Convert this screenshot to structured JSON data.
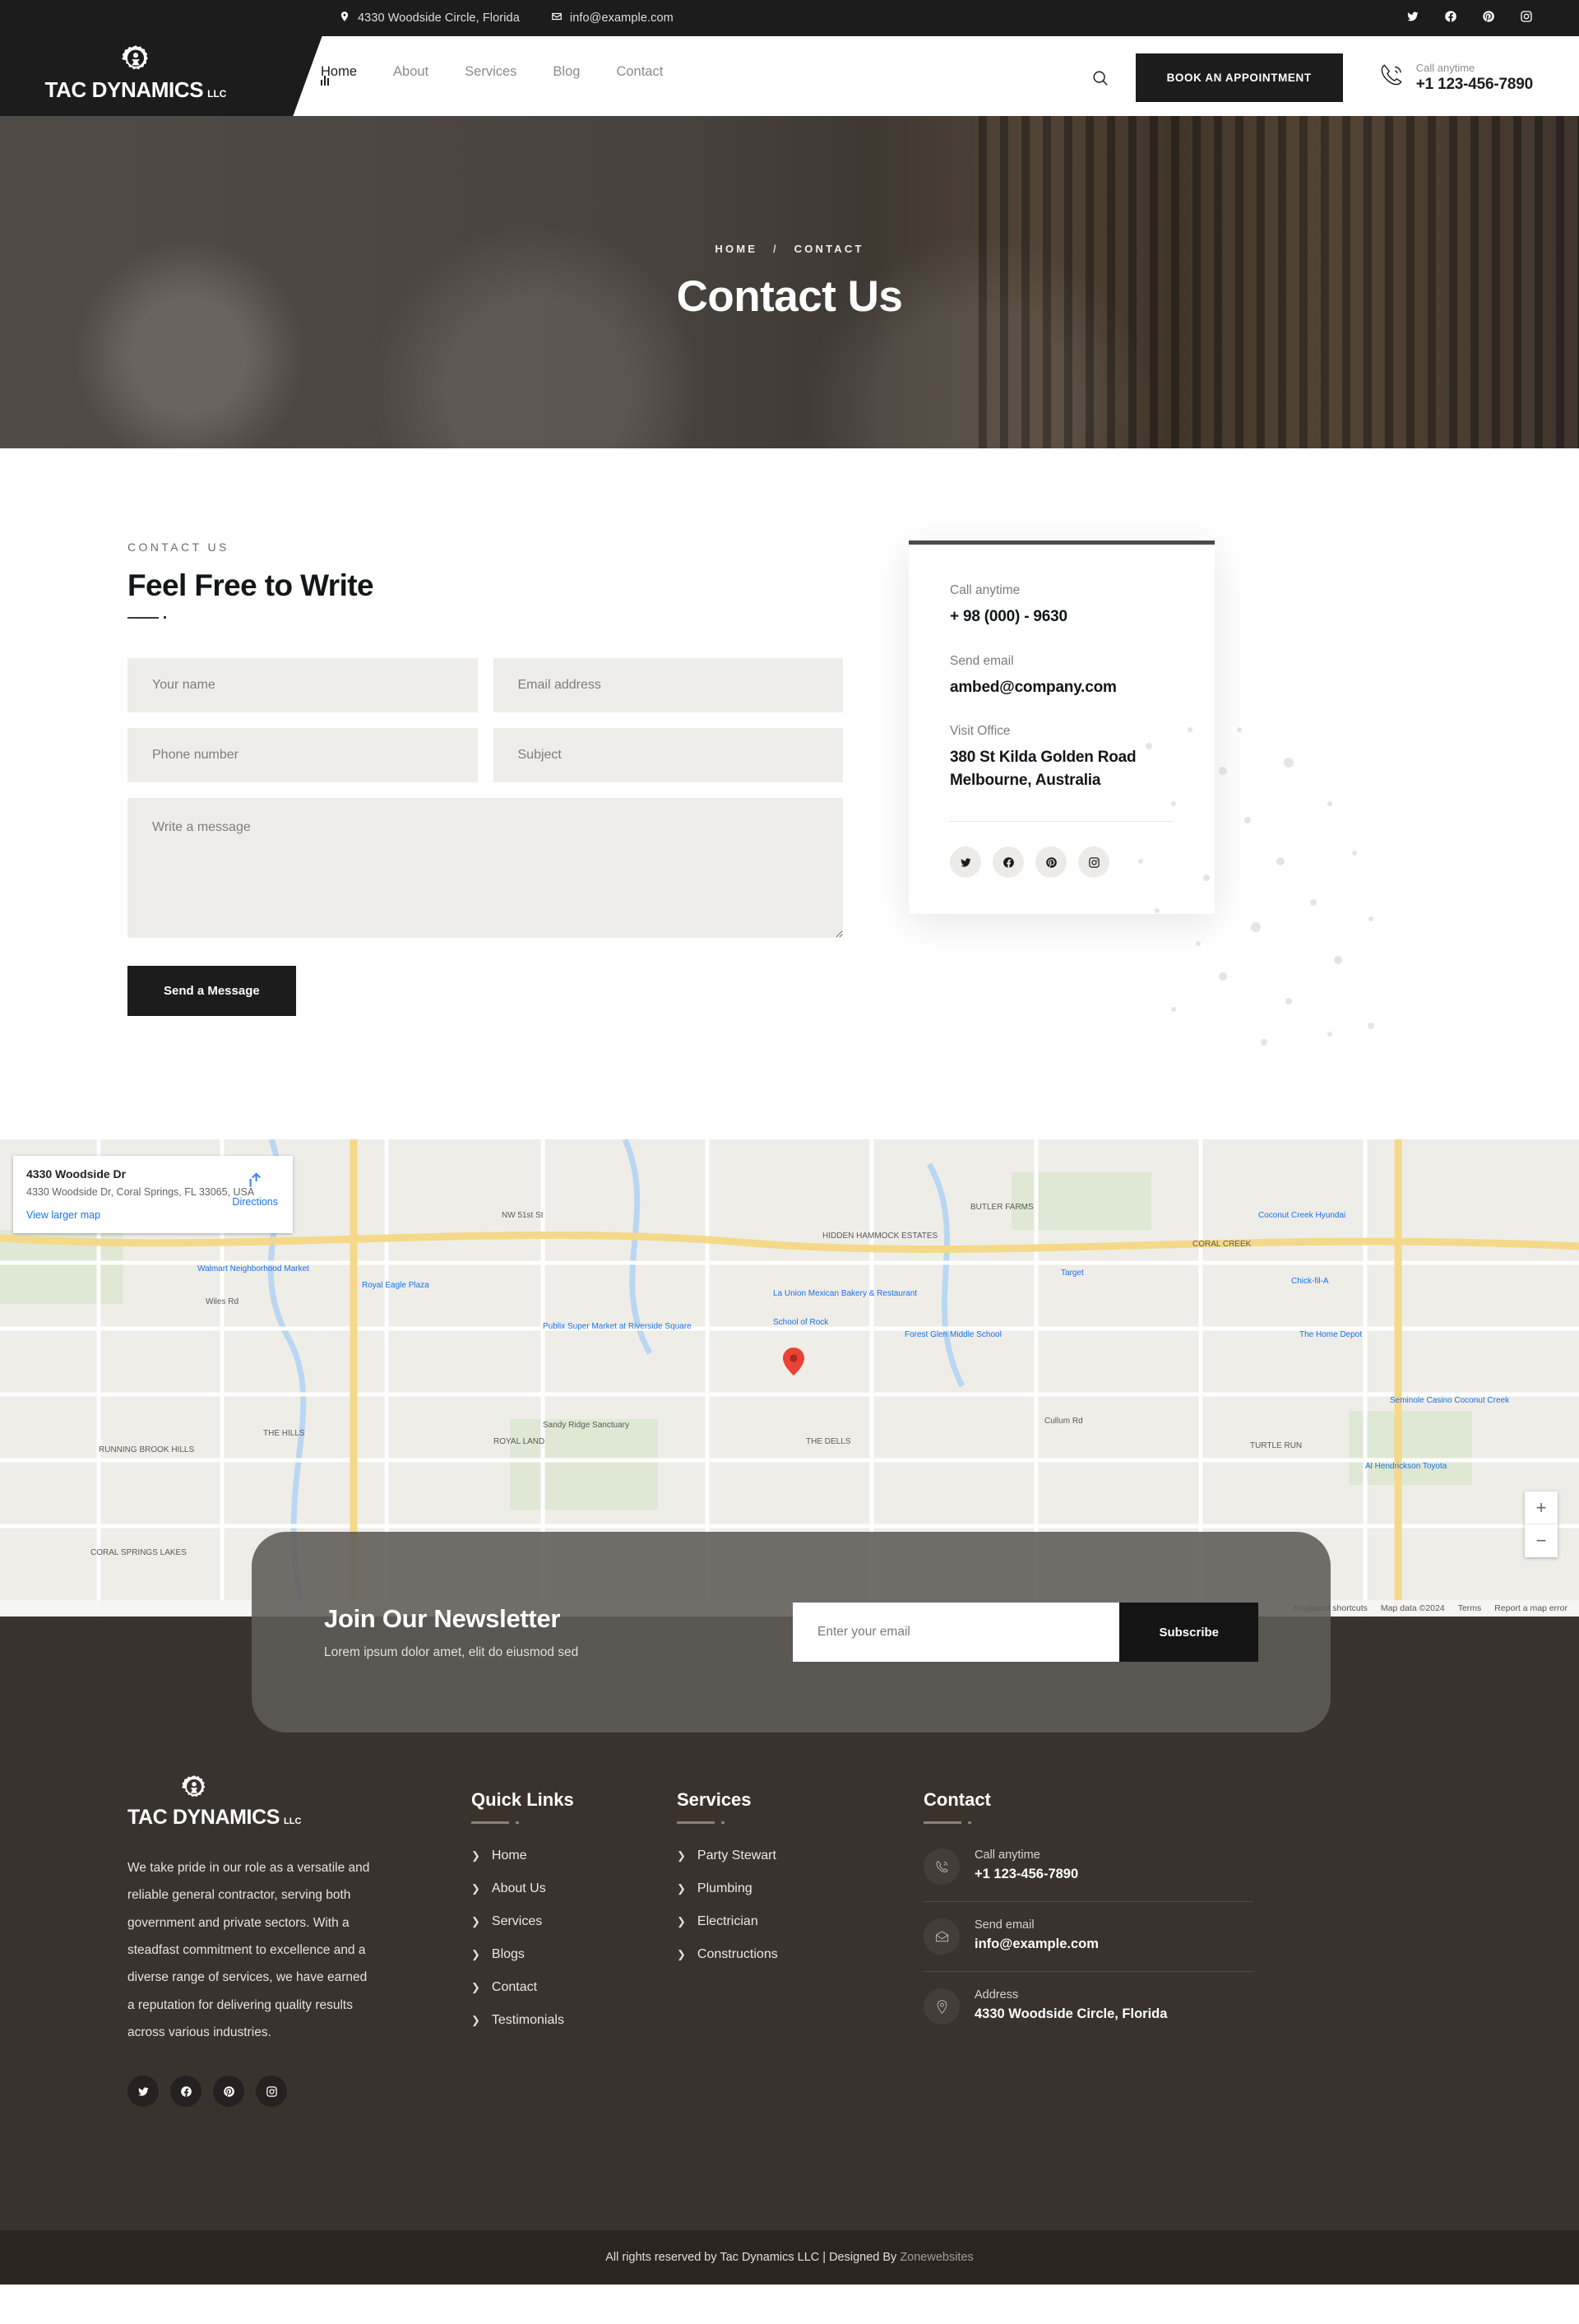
{
  "topbar": {
    "address": "4330 Woodside Circle, Florida",
    "email": "info@example.com",
    "socials": [
      "twitter-icon",
      "facebook-icon",
      "pinterest-icon",
      "instagram-icon"
    ]
  },
  "brand": {
    "name": "TAC DYNAMICS",
    "suffix": "LLC"
  },
  "nav": {
    "items": [
      {
        "label": "Home",
        "active": true
      },
      {
        "label": "About",
        "active": false
      },
      {
        "label": "Services",
        "active": false
      },
      {
        "label": "Blog",
        "active": false
      },
      {
        "label": "Contact",
        "active": false
      }
    ],
    "search_icon": "search-icon",
    "appointment_button": "BOOK AN APPOINTMENT",
    "phone_label": "Call anytime",
    "phone_number": "+1 123-456-7890"
  },
  "hero": {
    "crumb_home": "HOME",
    "crumb_sep": "/",
    "crumb_current": "CONTACT",
    "title": "Contact Us"
  },
  "contact": {
    "eyebrow": "CONTACT US",
    "title": "Feel Free to Write",
    "fields": {
      "name_placeholder": "Your name",
      "email_placeholder": "Email address",
      "phone_placeholder": "Phone number",
      "subject_placeholder": "Subject",
      "message_placeholder": "Write a message"
    },
    "submit_label": "Send a Message",
    "card": {
      "call_label": "Call anytime",
      "call_value": "+ 98 (000) - 9630",
      "email_label": "Send email",
      "email_value": "ambed@company.com",
      "office_label": "Visit Office",
      "office_line1": "380 St Kilda Golden Road",
      "office_line2": "Melbourne, Australia",
      "socials": [
        "twitter-icon",
        "facebook-icon",
        "pinterest-icon",
        "instagram-icon"
      ]
    }
  },
  "map": {
    "card_title": "4330 Woodside Dr",
    "card_address": "4330 Woodside Dr, Coral Springs, FL 33065, USA",
    "view_larger": "View larger map",
    "directions": "Directions",
    "zoom_in": "+",
    "zoom_out": "−",
    "keyboard_shortcuts": "Keyboard shortcuts",
    "map_data": "Map data ©2024",
    "terms": "Terms",
    "report": "Report a map error"
  },
  "newsletter": {
    "title": "Join Our Newsletter",
    "subtitle": "Lorem ipsum dolor amet, elit do eiusmod sed",
    "input_placeholder": "Enter your email",
    "button_label": "Subscribe"
  },
  "footer": {
    "description": "We take pride in our role as a versatile and reliable general contractor, serving both government and private sectors. With a steadfast commitment to excellence and a diverse range of services, we have earned a reputation for delivering quality results across various industries.",
    "socials": [
      "twitter-icon",
      "facebook-icon",
      "pinterest-icon",
      "instagram-icon"
    ],
    "quick_links": {
      "heading": "Quick Links",
      "items": [
        "Home",
        "About Us",
        "Services",
        "Blogs",
        "Contact",
        "Testimonials"
      ]
    },
    "services": {
      "heading": "Services",
      "items": [
        "Party Stewart",
        "Plumbing",
        "Electrician",
        "Constructions"
      ]
    },
    "contact": {
      "heading": "Contact",
      "items": [
        {
          "icon": "phone-icon",
          "label": "Call anytime",
          "value": "+1 123-456-7890"
        },
        {
          "icon": "mail-icon",
          "label": "Send email",
          "value": "info@example.com"
        },
        {
          "icon": "location-icon",
          "label": "Address",
          "value": "4330 Woodside Circle, Florida"
        }
      ]
    },
    "bottom_text": "All rights reserved by Tac Dynamics LLC | Designed By ",
    "bottom_link": "Zonewebsites"
  },
  "colors": {
    "dark": "#1c1c1c",
    "footer_bg": "#3a322c",
    "footer_bottom": "#2b2521",
    "field_bg": "#efedea",
    "map_link": "#1a73e8"
  }
}
